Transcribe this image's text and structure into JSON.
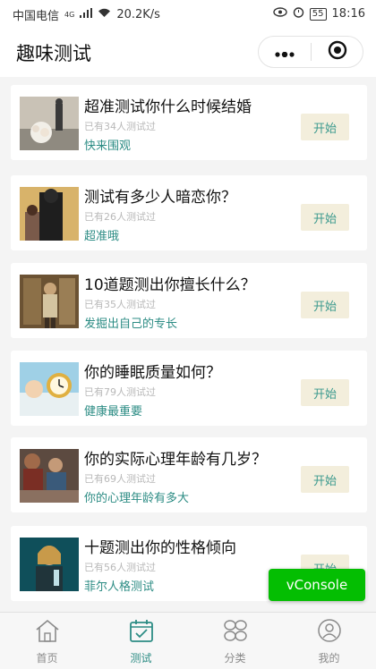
{
  "status_bar": {
    "carrier": "中国电信",
    "network_type": "4G",
    "speed": "20.2K/s",
    "battery": "55",
    "time": "18:16"
  },
  "nav": {
    "title": "趣味测试",
    "more_icon": "more-dots-icon",
    "close_icon": "target-circle-icon"
  },
  "tests": [
    {
      "title": "超准测试你什么时候结婚",
      "count": "已有34人测试过",
      "tag": "快来围观",
      "button": "开始",
      "thumb": "wedding-couple-photo"
    },
    {
      "title": "测试有多少人暗恋你？",
      "count": "已有26人测试过",
      "tag": "超准哦",
      "button": "开始",
      "thumb": "couple-behind-photo"
    },
    {
      "title": "10道题测出你擅长什么？",
      "count": "已有35人测试过",
      "tag": "发掘出自己的专长",
      "button": "开始",
      "thumb": "vintage-man-photo"
    },
    {
      "title": "你的睡眠质量如何？",
      "count": "已有79人测试过",
      "tag": "健康最重要",
      "button": "开始",
      "thumb": "alarm-clock-illustration"
    },
    {
      "title": "你的实际心理年龄有几岁？",
      "count": "已有69人测试过",
      "tag": "你的心理年龄有多大",
      "button": "开始",
      "thumb": "painting-crowd-photo"
    },
    {
      "title": "十题测出你的性格倾向",
      "count": "已有56人测试过",
      "tag": "菲尔人格测试",
      "button": "开始",
      "thumb": "woman-portrait-photo"
    }
  ],
  "vconsole": {
    "label": "vConsole"
  },
  "tabbar": {
    "tabs": [
      {
        "label": "首页",
        "icon": "home-icon"
      },
      {
        "label": "测试",
        "icon": "calendar-check-icon"
      },
      {
        "label": "分类",
        "icon": "grid-leaves-icon"
      },
      {
        "label": "我的",
        "icon": "user-icon"
      }
    ],
    "active_index": 1,
    "active_color": "#2c8c84",
    "inactive_color": "#8a8a8a"
  }
}
